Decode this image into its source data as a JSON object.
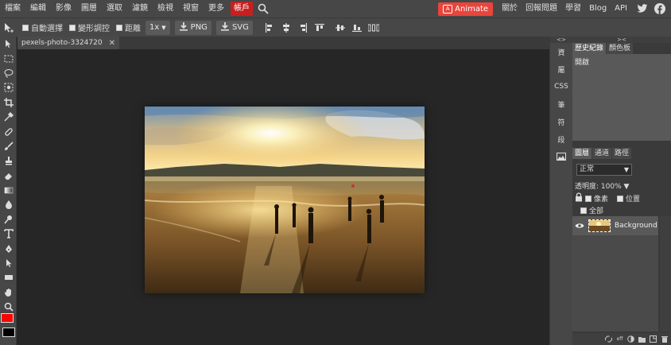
{
  "menu": {
    "items": [
      "檔案",
      "編輯",
      "影像",
      "圖層",
      "選取",
      "濾鏡",
      "檢視",
      "視窗",
      "更多"
    ],
    "account": "帳戶",
    "animate": "Animate",
    "right_links": [
      "關於",
      "回報問題",
      "學習",
      "Blog",
      "API"
    ]
  },
  "options": {
    "auto_select": "自動選擇",
    "transform_controls": "變形調控",
    "distances": "距離",
    "zoom": "1x",
    "png": "PNG",
    "svg": "SVG"
  },
  "document": {
    "tab_name": "pexels-photo-3324720",
    "close": "✕"
  },
  "minicol": {
    "header": "<>",
    "items": [
      "資",
      "屬",
      "CSS",
      "筆",
      "符",
      "段"
    ]
  },
  "panels": {
    "header": "><",
    "top_tabs": [
      "歷史紀錄",
      "顏色板"
    ],
    "history_item": "開啟",
    "layer_tabs": [
      "圖層",
      "通道",
      "路徑"
    ],
    "blend_mode": "正常",
    "opacity_label": "透明度:",
    "opacity_value": "100%",
    "lock_pixels": "像素",
    "lock_position": "位置",
    "lock_all": "全部",
    "layer_name": "Background",
    "foot": [
      "ɑ",
      "eff",
      "◐",
      "▭",
      "▬",
      "🗑"
    ]
  },
  "tool_colors": {
    "foreground": "#ff0000",
    "background": "#000000",
    "accent": "#c71f1f",
    "animate": "#e8453c"
  }
}
